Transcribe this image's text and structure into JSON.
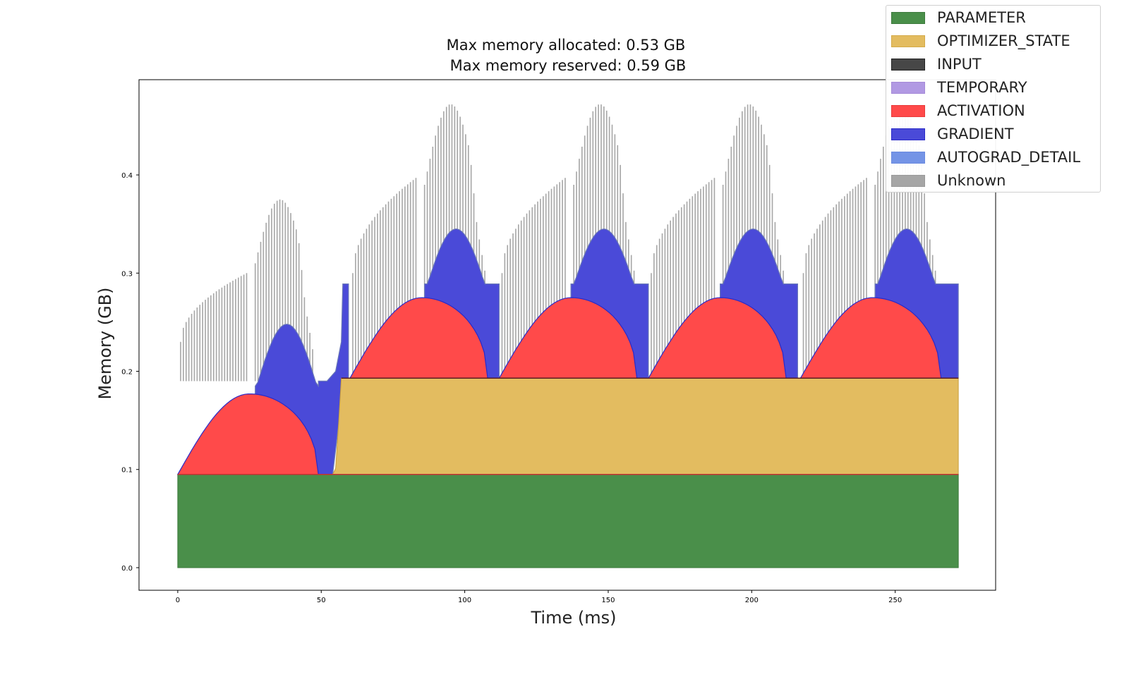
{
  "chart_data": {
    "type": "area",
    "title": [
      "Max memory allocated: 0.53 GB",
      "Max memory reserved: 0.59 GB"
    ],
    "xlabel": "Time (ms)",
    "ylabel": "Memory (GB)",
    "xlim": [
      -13.5,
      285
    ],
    "ylim": [
      -0.023,
      0.497
    ],
    "xticks": [
      0,
      50,
      100,
      150,
      200,
      250
    ],
    "xtick_labels": [
      "0",
      "50",
      "100",
      "150",
      "200",
      "250"
    ],
    "yticks": [
      0.0,
      0.1,
      0.2,
      0.3,
      0.4
    ],
    "ytick_labels": [
      "0.0",
      "0.1",
      "0.2",
      "0.3",
      "0.4"
    ],
    "grid": false,
    "legend_position": "top-right",
    "stacked": true,
    "legend": [
      {
        "name": "PARAMETER",
        "color": "#4a8f4a",
        "edge": "#3d7a3d"
      },
      {
        "name": "OPTIMIZER_STATE",
        "color": "#e3bc60",
        "edge": "#d4aa48"
      },
      {
        "name": "INPUT",
        "color": "#474747",
        "edge": "#222222"
      },
      {
        "name": "TEMPORARY",
        "color": "#b199e3",
        "edge": "#a58ad8"
      },
      {
        "name": "ACTIVATION",
        "color": "#ff4a4a",
        "edge": "#e83a3a"
      },
      {
        "name": "GRADIENT",
        "color": "#4a4ad8",
        "edge": "#2a2ac8"
      },
      {
        "name": "AUTOGRAD_DETAIL",
        "color": "#7494e6",
        "edge": "#6a8ae0"
      },
      {
        "name": "Unknown",
        "color": "#a6a6a6",
        "edge": "#999999"
      }
    ],
    "series": [
      {
        "name": "PARAMETER",
        "segments": [
          {
            "x_start": 0,
            "x_end": 272,
            "value": 0.095
          }
        ]
      },
      {
        "name": "OPTIMIZER_STATE",
        "points": [
          [
            0,
            0
          ],
          [
            54,
            0
          ],
          [
            55,
            0.006
          ],
          [
            56,
            0.05
          ],
          [
            57,
            0.098
          ],
          [
            272,
            0.098
          ]
        ]
      },
      {
        "name": "ACTIVATION",
        "iterations": [
          {
            "x_start": 0,
            "x_peak": 25,
            "x_end": 49,
            "peak_total": 0.177,
            "base_total": 0.095
          },
          {
            "x_start": 60,
            "x_peak": 85,
            "x_end": 108,
            "peak_total": 0.275,
            "base_total": 0.193
          },
          {
            "x_start": 112,
            "x_peak": 137,
            "x_end": 160,
            "peak_total": 0.275,
            "base_total": 0.193
          },
          {
            "x_start": 164,
            "x_peak": 189,
            "x_end": 212,
            "peak_total": 0.275,
            "base_total": 0.193
          },
          {
            "x_start": 217,
            "x_peak": 242,
            "x_end": 266,
            "peak_total": 0.275,
            "base_total": 0.193
          }
        ]
      },
      {
        "name": "GRADIENT",
        "iterations": [
          {
            "x_rise": 27,
            "x_peak": 38,
            "x_fall": 49,
            "peak_total": 0.248,
            "plateau_total": 0.19,
            "x_end": 59
          },
          {
            "x_rise": 86,
            "x_peak": 97,
            "x_fall": 108,
            "peak_total": 0.345,
            "plateau_total": 0.289,
            "x_end": 112
          },
          {
            "x_rise": 137,
            "x_peak": 149,
            "x_fall": 160,
            "peak_total": 0.345,
            "plateau_total": 0.289,
            "x_end": 164
          },
          {
            "x_rise": 189,
            "x_peak": 200,
            "x_fall": 212,
            "peak_total": 0.345,
            "plateau_total": 0.289,
            "x_end": 216
          },
          {
            "x_rise": 243,
            "x_peak": 254,
            "x_fall": 265,
            "peak_total": 0.345,
            "plateau_total": 0.289,
            "x_end": 272
          }
        ]
      },
      {
        "name": "Unknown",
        "spike_groups": [
          {
            "x_start": 1,
            "x_end": 24,
            "peak_start": 0.23,
            "peak_end": 0.3
          },
          {
            "x_start": 27,
            "x_end": 47,
            "peak_start": 0.31,
            "peak_end": 0.375
          },
          {
            "x_start": 61,
            "x_end": 83,
            "peak_start": 0.3,
            "peak_end": 0.397
          },
          {
            "x_start": 86,
            "x_end": 107,
            "peak_start": 0.39,
            "peak_end": 0.472
          },
          {
            "x_start": 113,
            "x_end": 135,
            "peak_start": 0.3,
            "peak_end": 0.397
          },
          {
            "x_start": 138,
            "x_end": 159,
            "peak_start": 0.39,
            "peak_end": 0.472
          },
          {
            "x_start": 165,
            "x_end": 187,
            "peak_start": 0.3,
            "peak_end": 0.397
          },
          {
            "x_start": 190,
            "x_end": 211,
            "peak_start": 0.39,
            "peak_end": 0.472
          },
          {
            "x_start": 218,
            "x_end": 240,
            "peak_start": 0.3,
            "peak_end": 0.397
          },
          {
            "x_start": 243,
            "x_end": 264,
            "peak_start": 0.39,
            "peak_end": 0.472
          }
        ]
      }
    ]
  }
}
